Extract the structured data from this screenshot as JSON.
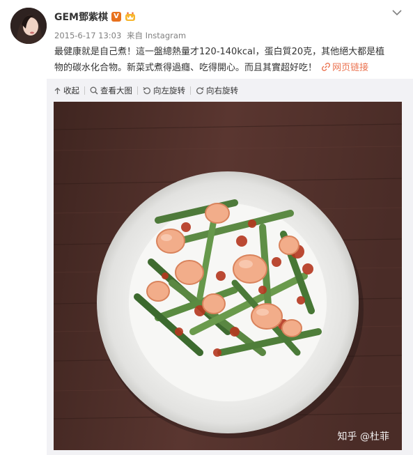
{
  "post": {
    "username": "GEM鄧紫棋",
    "verified_badge": "V",
    "date": "2015-6-17 13:03",
    "source": "来自 Instagram",
    "text_line1": "最健康就是自己煮！這一盤總熱量才120-140kcal，蛋白質20克，其他絕大都是植",
    "text_line2": "物的碳水化合物。新菜式煮得過癮、吃得開心。而且其實超好吃！",
    "web_link": "网页链接",
    "icons": [
      "chevron-down-icon",
      "crown-icon",
      "link-icon",
      "collapse-arrow-icon",
      "zoom-icon",
      "rotate-left-icon",
      "rotate-right-icon"
    ]
  },
  "toolbar": {
    "collapse": "收起",
    "view_large": "查看大图",
    "rotate_left": "向左旋转",
    "rotate_right": "向右旋转"
  },
  "watermark": {
    "text": "知乎 @杜菲"
  },
  "colors": {
    "link": "#eb7350",
    "badge": "#e8711d",
    "panel": "#f2f2f5"
  }
}
